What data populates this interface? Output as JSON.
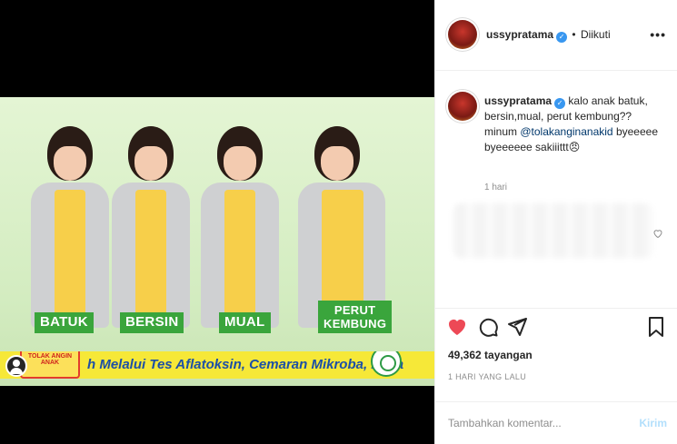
{
  "video": {
    "labels": [
      "BATUK",
      "BERSIN",
      "MUAL",
      "PERUT",
      "KEMBUNG"
    ],
    "ticker_text": "h Melalui Tes Aflatoksin, Cemaran Mikroba, Loga",
    "product_name": "TOLAK ANGIN ANAK"
  },
  "header": {
    "username": "ussypratama",
    "separator": "•",
    "follow_status": "Diikuti",
    "more_icon": "more-horizontal-icon"
  },
  "caption": {
    "username": "ussypratama",
    "text_1": "kalo anak batuk, bersin,mual, perut kembung?? minum ",
    "mention": "@tolakanginanakid",
    "text_2": " byeeeee byeeeeee sakiiittt",
    "emoji": "😠",
    "time": "1 hari"
  },
  "actions": {
    "like_icon": "heart-filled-icon",
    "comment_icon": "comment-icon",
    "share_icon": "share-icon",
    "save_icon": "bookmark-icon",
    "like_color": "#ed4956"
  },
  "stats": {
    "views": "49,362 tayangan",
    "posted_ago": "1 HARI YANG LALU"
  },
  "comment_form": {
    "placeholder": "Tambahkan komentar...",
    "post_label": "Kirim"
  }
}
